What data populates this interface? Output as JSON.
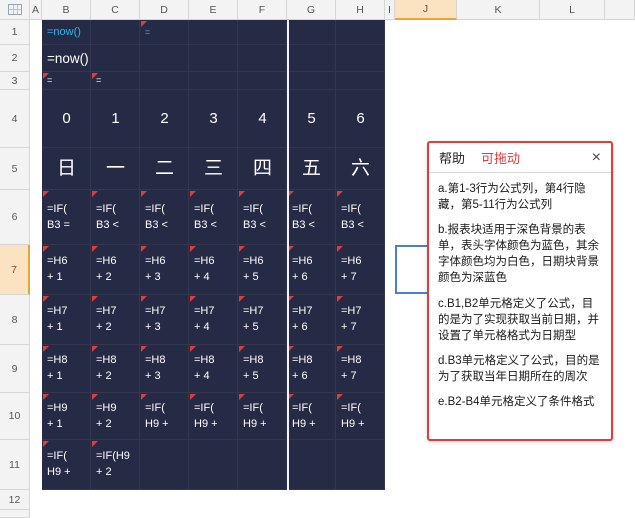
{
  "selection": {
    "column": "J",
    "row": "7"
  },
  "colors": {
    "dark_block": "#262b45",
    "formula_text": "#ffffff",
    "accent_cyan": "#2eb6ea",
    "selection_border": "#4a7ed0",
    "panel_border": "#e23b3b",
    "flag_red": "#e23b3b",
    "header_selected": "#fbe2c0"
  },
  "grid": {
    "column_headers": [
      "A",
      "B",
      "C",
      "D",
      "E",
      "F",
      "G",
      "H",
      "I",
      "J",
      "K",
      "L"
    ],
    "row_headers": [
      "1",
      "2",
      "3",
      "4",
      "5",
      "6",
      "7",
      "8",
      "9",
      "10",
      "11",
      "12"
    ],
    "rows": [
      {
        "cells": [
          {
            "lines": [
              "=now()"
            ],
            "cls": "cyan f11"
          },
          null,
          {
            "lines": [
              "="
            ],
            "cls": "cyan f9",
            "flag": true
          },
          null,
          null,
          null,
          null
        ]
      },
      {
        "cells": [
          {
            "lines": [
              "=now()"
            ],
            "cls": "f13"
          },
          null,
          null,
          null,
          null,
          null,
          null
        ]
      },
      {
        "cells": [
          {
            "lines": [
              "="
            ],
            "cls": "f9",
            "flag": true
          },
          {
            "lines": [
              "="
            ],
            "cls": "f9",
            "flag": true
          },
          null,
          null,
          null,
          null,
          null
        ]
      },
      {
        "cells": [
          {
            "lines": [
              "0"
            ],
            "cls": "num center"
          },
          {
            "lines": [
              "1"
            ],
            "cls": "num center"
          },
          {
            "lines": [
              "2"
            ],
            "cls": "num center"
          },
          {
            "lines": [
              "3"
            ],
            "cls": "num center"
          },
          {
            "lines": [
              "4"
            ],
            "cls": "num center"
          },
          {
            "lines": [
              "5"
            ],
            "cls": "num center"
          },
          {
            "lines": [
              "6"
            ],
            "cls": "num center"
          }
        ]
      },
      {
        "cells": [
          {
            "lines": [
              "日"
            ],
            "cls": "day center"
          },
          {
            "lines": [
              "一"
            ],
            "cls": "day center"
          },
          {
            "lines": [
              "二"
            ],
            "cls": "day center"
          },
          {
            "lines": [
              "三"
            ],
            "cls": "day center"
          },
          {
            "lines": [
              "四"
            ],
            "cls": "day center"
          },
          {
            "lines": [
              "五"
            ],
            "cls": "day center"
          },
          {
            "lines": [
              "六"
            ],
            "cls": "day center"
          }
        ]
      },
      {
        "cells": [
          {
            "lines": [
              "=IF(",
              "B3 ="
            ],
            "flag": true
          },
          {
            "lines": [
              "=IF(",
              "B3 <"
            ],
            "flag": true
          },
          {
            "lines": [
              "=IF(",
              "B3 <"
            ],
            "flag": true
          },
          {
            "lines": [
              "=IF(",
              "B3 <"
            ],
            "flag": true
          },
          {
            "lines": [
              "=IF(",
              "B3 <"
            ],
            "flag": true
          },
          {
            "lines": [
              "=IF(",
              "B3 <"
            ],
            "flag": true
          },
          {
            "lines": [
              "=IF(",
              "B3 <"
            ],
            "flag": true
          }
        ]
      },
      {
        "cells": [
          {
            "lines": [
              "=H6",
              "+ 1"
            ],
            "flag": true
          },
          {
            "lines": [
              "=H6",
              "+ 2"
            ],
            "flag": true
          },
          {
            "lines": [
              "=H6",
              "+ 3"
            ],
            "flag": true
          },
          {
            "lines": [
              "=H6",
              "+ 4"
            ],
            "flag": true
          },
          {
            "lines": [
              "=H6",
              "+ 5"
            ],
            "flag": true
          },
          {
            "lines": [
              "=H6",
              "+ 6"
            ],
            "flag": true
          },
          {
            "lines": [
              "=H6",
              "+ 7"
            ],
            "flag": true
          }
        ]
      },
      {
        "cells": [
          {
            "lines": [
              "=H7",
              "+ 1"
            ],
            "flag": true
          },
          {
            "lines": [
              "=H7",
              "+ 2"
            ],
            "flag": true
          },
          {
            "lines": [
              "=H7",
              "+ 3"
            ],
            "flag": true
          },
          {
            "lines": [
              "=H7",
              "+ 4"
            ],
            "flag": true
          },
          {
            "lines": [
              "=H7",
              "+ 5"
            ],
            "flag": true
          },
          {
            "lines": [
              "=H7",
              "+ 6"
            ],
            "flag": true
          },
          {
            "lines": [
              "=H7",
              "+ 7"
            ],
            "flag": true
          }
        ]
      },
      {
        "cells": [
          {
            "lines": [
              "=H8",
              "+ 1"
            ],
            "flag": true
          },
          {
            "lines": [
              "=H8",
              "+ 2"
            ],
            "flag": true
          },
          {
            "lines": [
              "=H8",
              "+ 3"
            ],
            "flag": true
          },
          {
            "lines": [
              "=H8",
              "+ 4"
            ],
            "flag": true
          },
          {
            "lines": [
              "=H8",
              "+ 5"
            ],
            "flag": true
          },
          {
            "lines": [
              "=H8",
              "+ 6"
            ],
            "flag": true
          },
          {
            "lines": [
              "=H8",
              "+ 7"
            ],
            "flag": true
          }
        ]
      },
      {
        "cells": [
          {
            "lines": [
              "=H9",
              "+ 1"
            ],
            "flag": true
          },
          {
            "lines": [
              "=H9",
              "+ 2"
            ],
            "flag": true
          },
          {
            "lines": [
              "=IF(",
              "H9 +"
            ],
            "flag": true
          },
          {
            "lines": [
              "=IF(",
              "H9 +"
            ],
            "flag": true
          },
          {
            "lines": [
              "=IF(",
              "H9 +"
            ],
            "flag": true
          },
          {
            "lines": [
              "=IF(",
              "H9 +"
            ],
            "flag": true
          },
          {
            "lines": [
              "=IF(",
              "H9 +"
            ],
            "flag": true
          }
        ]
      },
      {
        "cells": [
          {
            "lines": [
              "=IF(",
              "H9 +"
            ],
            "flag": true
          },
          {
            "lines": [
              "=IF(H9",
              "+ 2"
            ],
            "flag": true
          },
          null,
          null,
          null,
          null,
          null
        ]
      }
    ]
  },
  "help_panel": {
    "title": "帮助",
    "drag_hint": "可拖动",
    "close_label": "×",
    "paragraphs": [
      "a.第1-3行为公式列，第4行隐藏，第5-11行为公式列",
      "b.报表块适用于深色背景的表单，表头字体颜色为蓝色，其余字体颜色均为白色，日期块背景颜色为深蓝色",
      "c.B1,B2单元格定义了公式，目的是为了实现获取当前日期，并设置了单元格格式为日期型",
      "d.B3单元格定义了公式，目的是为了获取当年日期所在的周次",
      "e.B2-B4单元格定义了条件格式"
    ]
  }
}
